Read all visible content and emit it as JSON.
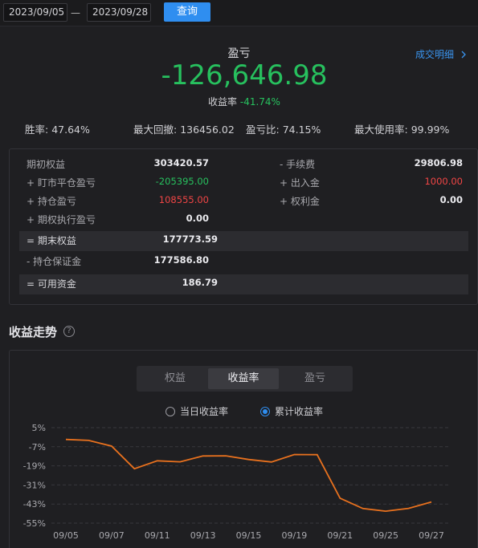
{
  "filter": {
    "start_date": "2023/09/05",
    "separator": "—",
    "end_date": "2023/09/28",
    "query_label": "查询"
  },
  "summary": {
    "title": "盈亏",
    "trade_detail_link": "成交明细",
    "pnl_value": "-126,646.98",
    "return_label": "收益率",
    "return_value": "-41.74%"
  },
  "stats": [
    {
      "label": "胜率:",
      "value": "47.64%"
    },
    {
      "label": "最大回撤:",
      "value": "136456.02"
    },
    {
      "label": "盈亏比:",
      "value": "74.15%"
    },
    {
      "label": "最大使用率:",
      "value": "99.99%"
    }
  ],
  "equity": {
    "left": [
      {
        "label": "期初权益",
        "value": "303420.57"
      },
      {
        "label": "+ 盯市平仓盈亏",
        "value": "-205395.00"
      },
      {
        "label": "+ 持仓盈亏",
        "value": "108555.00"
      },
      {
        "label": "+ 期权执行盈亏",
        "value": "0.00"
      }
    ],
    "right": [
      {
        "label": "- 手续费",
        "value": "29806.98"
      },
      {
        "label": "+ 出入金",
        "value": "1000.00"
      },
      {
        "label": "+ 权利金",
        "value": "0.00"
      }
    ],
    "end_equity": {
      "label": "= 期末权益",
      "value": "177773.59"
    },
    "margin": {
      "label": "- 持仓保证金",
      "value": "177586.80"
    },
    "available": {
      "label": "= 可用资金",
      "value": "186.79"
    }
  },
  "trend": {
    "title": "收益走势",
    "help_icon": "question-circle-icon",
    "tabs": [
      "权益",
      "收益率",
      "盈亏"
    ],
    "active_tab": "收益率",
    "radios": [
      {
        "label": "当日收益率",
        "checked": false
      },
      {
        "label": "累计收益率",
        "checked": true
      }
    ]
  },
  "colors": {
    "accent_blue": "#2f8ef0",
    "profit_green": "#27c05e",
    "loss_red": "#f04545",
    "line_orange": "#e8711e"
  },
  "chart_data": {
    "type": "line",
    "series": [
      {
        "x": [
          "09/05",
          "09/06",
          "09/07",
          "09/08",
          "09/11",
          "09/12",
          "09/13",
          "09/14",
          "09/15",
          "09/18",
          "09/19",
          "09/20",
          "09/21",
          "09/22",
          "09/25",
          "09/26",
          "09/27",
          "09/28"
        ],
        "values": [
          -2.4,
          -3.0,
          -6.6,
          -20.8,
          -15.8,
          -16.5,
          -12.8,
          -12.7,
          -15.0,
          -16.6,
          -11.9,
          -12.0,
          -39.3,
          -45.8,
          -47.5,
          -45.7,
          -41.7,
          -41.7
        ]
      }
    ],
    "x_tick_labels": [
      "09/05",
      "09/07",
      "09/11",
      "09/13",
      "09/15",
      "09/19",
      "09/21",
      "09/25",
      "09/27"
    ],
    "y_tick_labels": [
      "5%",
      "-7%",
      "-19%",
      "-31%",
      "-43%",
      "-55%"
    ],
    "ylim": [
      -55,
      5
    ],
    "grid": "horizontal dashed"
  }
}
